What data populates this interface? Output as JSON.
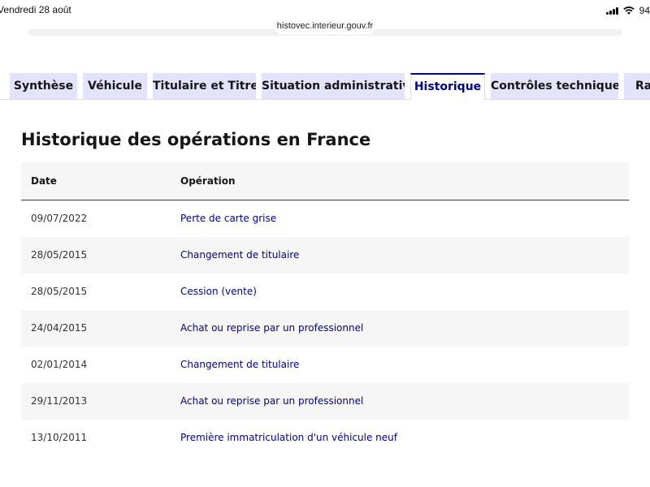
{
  "status_bar": {
    "date": "Vendredi 28 août",
    "battery": "94"
  },
  "browser": {
    "url": "histovec.interieur.gouv.fr"
  },
  "tabs": [
    {
      "label": "Synthèse"
    },
    {
      "label": "Véhicule"
    },
    {
      "label": "Titulaire et Titre"
    },
    {
      "label": "Situation administrative"
    },
    {
      "label": "Historique"
    },
    {
      "label": "Contrôles techniques"
    },
    {
      "label": "Rap"
    }
  ],
  "active_tab": "Historique",
  "main": {
    "title": "Historique des opérations en France",
    "table": {
      "headers": {
        "date": "Date",
        "operation": "Opération"
      },
      "rows": [
        {
          "date": "09/07/2022",
          "operation": "Perte de carte grise"
        },
        {
          "date": "28/05/2015",
          "operation": "Changement de titulaire"
        },
        {
          "date": "28/05/2015",
          "operation": "Cession (vente)"
        },
        {
          "date": "24/04/2015",
          "operation": "Achat ou reprise par un professionnel"
        },
        {
          "date": "02/01/2014",
          "operation": "Changement de titulaire"
        },
        {
          "date": "29/11/2013",
          "operation": "Achat ou reprise par un professionnel"
        },
        {
          "date": "13/10/2011",
          "operation": "Première immatriculation d'un véhicule neuf"
        }
      ]
    }
  },
  "colors": {
    "accent": "#000091",
    "tab_bg": "#e3e3fd",
    "row_alt": "#f6f6f6"
  }
}
